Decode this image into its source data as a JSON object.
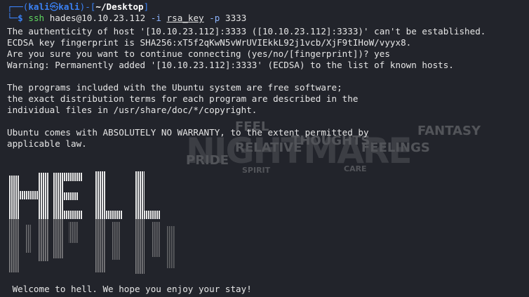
{
  "prompt": {
    "open": "┌──(",
    "user": "kali",
    "at": "㉿",
    "host": "kali",
    "mid": ")-[",
    "dir": "~/Desktop",
    "close": "]",
    "arrow": "└─",
    "dollar": "$"
  },
  "command": {
    "program": "ssh",
    "target": "hades@10.10.23.112",
    "flag_i": "-i",
    "key": "rsa_key",
    "flag_p": "-p",
    "port": "3333"
  },
  "output": [
    "The authenticity of host '[10.10.23.112]:3333 ([10.10.23.112]:3333)' can't be established.",
    "ECDSA key fingerprint is SHA256:xT5f2qKwN5vWrUVIEkkL92j1vcb/XjF9tIHoW/vyyx8.",
    "Are you sure you want to continue connecting (yes/no/[fingerprint])? yes",
    "Warning: Permanently added '[10.10.23.112]:3333' (ECDSA) to the list of known hosts.",
    "",
    "The programs included with the Ubuntu system are free software;",
    "the exact distribution terms for each program are described in the",
    "individual files in /usr/share/doc/*/copyright.",
    "",
    "Ubuntu comes with ABSOLUTELY NO WARRANTY, to the extent permitted by",
    "applicable law."
  ],
  "banner_art": "HELL",
  "banner_message": " Welcome to hell. We hope you enjoy your stay!",
  "wallpaper_words": [
    "FANTASY",
    "FEELINGS",
    "THOUGHTS",
    "RELATIVE",
    "CARE",
    "SPIRIT",
    "FEEL",
    "PRIDE",
    "NIGHTMARE"
  ],
  "colors": {
    "background": "#22242b",
    "prompt_blue": "#3b82f6",
    "command_green": "#5fd75f",
    "text": "#e6e6e6"
  }
}
